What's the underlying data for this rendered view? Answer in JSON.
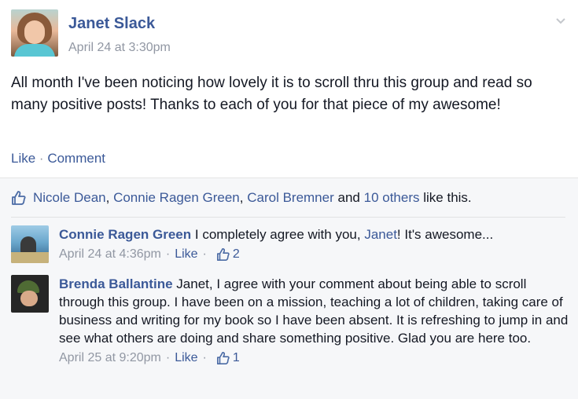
{
  "post": {
    "author": "Janet Slack",
    "timestamp": "April 24 at 3:30pm",
    "text": "All month I've been noticing how lovely it is to scroll thru this group and read so many positive posts! Thanks to each of you for that piece of my awesome!",
    "actions": {
      "like": "Like",
      "separator": "·",
      "comment": "Comment"
    }
  },
  "likes": {
    "names": [
      "Nicole Dean",
      "Connie Ragen Green",
      "Carol Bremner"
    ],
    "comma": ",",
    "and": "and",
    "others": "10 others",
    "suffix": "like this."
  },
  "comments": [
    {
      "author": "Connie Ragen Green",
      "text_before": "I completely agree with you,",
      "mention": "Janet",
      "text_after": "! It's awesome...",
      "timestamp": "April 24 at 4:36pm",
      "dot": "·",
      "like_label": "Like",
      "like_count": "2"
    },
    {
      "author": "Brenda Ballantine",
      "text": "Janet, I agree with your comment about being able to scroll through this group. I have been on a mission, teaching a lot of children, taking care of business and writing for my book so I have been absent. It is refreshing to jump in and see what others are doing and share something positive. Glad you are here too.",
      "timestamp": "April 25 at 9:20pm",
      "dot": "·",
      "like_label": "Like",
      "like_count": "1"
    }
  ],
  "colors": {
    "link": "#3b5998",
    "muted": "#9197a3",
    "feedback_bg": "#f6f7f9"
  },
  "icons": {
    "menu": "chevron-down-icon",
    "like": "thumbs-up-icon"
  }
}
